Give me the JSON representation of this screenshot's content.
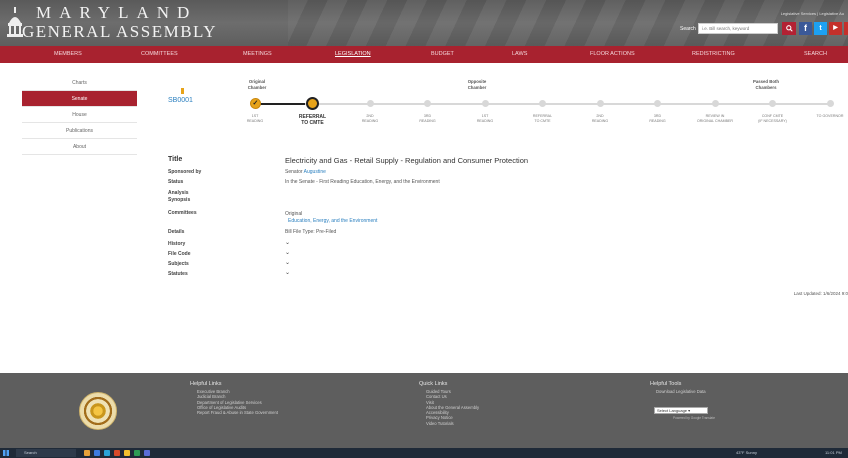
{
  "header": {
    "logo_line1": "MARYLAND",
    "logo_line2": "GENERAL ASSEMBLY",
    "top_links": "Legislative Services | Legislative Au",
    "search_label": "Search",
    "search_placeholder": "i.e. Bill search, keyword",
    "social": [
      "f",
      "t",
      "yt",
      "rss"
    ]
  },
  "nav": {
    "items": [
      "MEMBERS",
      "COMMITTEES",
      "MEETINGS",
      "LEGISLATION",
      "BUDGET",
      "LAWS",
      "FLOOR ACTIONS",
      "REDISTRICTING",
      "SEARCH"
    ],
    "active": "LEGISLATION"
  },
  "sidebar": {
    "items": [
      "Charts",
      "Senate",
      "House",
      "Publications",
      "About"
    ],
    "active": "Senate"
  },
  "bill": {
    "number": "SB0001"
  },
  "tracker": {
    "groups": [
      "Original\nChamber",
      "Opposite\nChamber",
      "Passed Both\nChambers"
    ],
    "steps": [
      {
        "label": "1ST\nREADING",
        "state": "done"
      },
      {
        "label": "REFERRAL\nTO CMTE",
        "state": "current"
      },
      {
        "label": "2ND\nREADING",
        "state": "todo"
      },
      {
        "label": "3RD\nREADING",
        "state": "todo"
      },
      {
        "label": "1ST\nREADING",
        "state": "todo"
      },
      {
        "label": "REFERRAL\nTO CMTE",
        "state": "todo"
      },
      {
        "label": "2ND\nREADING",
        "state": "todo"
      },
      {
        "label": "3RD\nREADING",
        "state": "todo"
      },
      {
        "label": "REVIEW IN\nORIGINAL CHAMBER",
        "state": "todo"
      },
      {
        "label": "CONF CMTE\n(IF NECESSARY)",
        "state": "todo"
      },
      {
        "label": "TO GOVERNOR",
        "state": "todo"
      }
    ]
  },
  "details": {
    "title_label": "Title",
    "title_value": "Electricity and Gas - Retail Supply - Regulation and Consumer Protection",
    "sponsored_label": "Sponsored by",
    "sponsored_prefix": "Senator ",
    "sponsored_name": "Augustine",
    "status_label": "Status",
    "status_value": "In the Senate - First Reading Education, Energy, and the Environment",
    "analysis_label": "Analysis",
    "synopsis_label": "Synopsis",
    "committees_label": "Committees",
    "committees_heading": "Original",
    "committees_value": "Education, Energy, and the Environment",
    "details_label": "Details",
    "details_value": "Bill File Type: Pre-Filed",
    "history_label": "History",
    "filecode_label": "File Code",
    "subjects_label": "Subjects",
    "statutes_label": "Statutes",
    "chevron": "⌵"
  },
  "last_updated": "Last Updated: 1/6/2024 9:0",
  "footer": {
    "helpful_links_title": "Helpful Links",
    "helpful_links": [
      "Executive Branch",
      "Judicial Branch",
      "Department of Legislative Services",
      "Office of Legislative Audits",
      "Report Fraud & Abuse in State Government"
    ],
    "quick_links_title": "Quick Links",
    "quick_links": [
      "Guided Tours",
      "Contact Us",
      "Visit",
      "About the General Assembly",
      "Accessibility",
      "Privacy Notice",
      "Video Tutorials"
    ],
    "helpful_tools_title": "Helpful Tools",
    "helpful_tools": [
      "Download Legislative Data"
    ],
    "language_select": "Select Language",
    "translate_powered": "Powered by Google Translate"
  },
  "taskbar": {
    "search_placeholder": "Search",
    "weather": "43°F Sunny",
    "time": "11:01 PM"
  },
  "colors": {
    "nav_red": "#a8222f",
    "accent_gold": "#e7a319",
    "link_blue": "#2a7fbf",
    "footer_gray": "#5e5e5e"
  }
}
